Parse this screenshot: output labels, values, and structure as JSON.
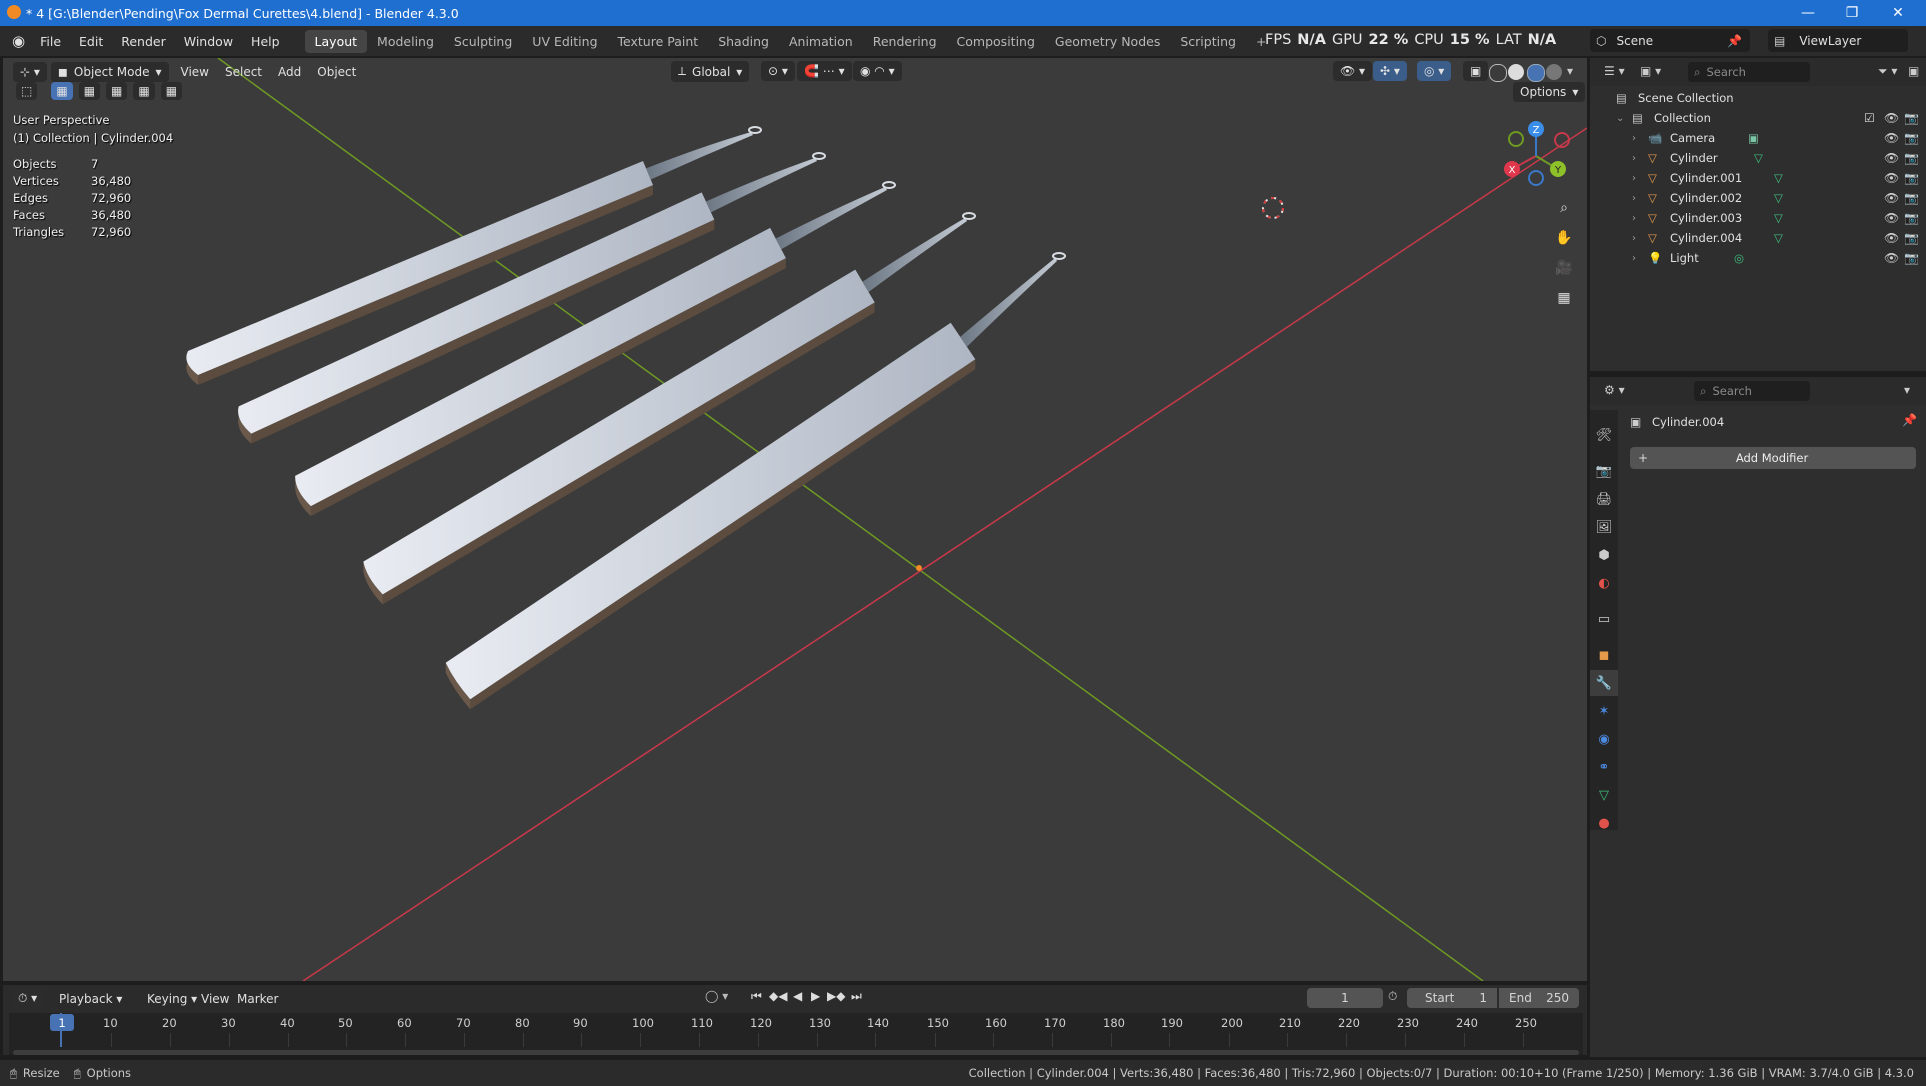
{
  "window": {
    "title": "* 4 [G:\\Blender\\Pending\\Fox Dermal Curettes\\4.blend] - Blender 4.3.0",
    "minimize": "—",
    "maximize": "❐",
    "close": "✕"
  },
  "menu": {
    "items": [
      "File",
      "Edit",
      "Render",
      "Window",
      "Help"
    ],
    "workspaces": [
      "Layout",
      "Modeling",
      "Sculpting",
      "UV Editing",
      "Texture Paint",
      "Shading",
      "Animation",
      "Rendering",
      "Compositing",
      "Geometry Nodes",
      "Scripting"
    ],
    "active_workspace": "Layout",
    "add_workspace": "+",
    "stats": {
      "fps_label": "FPS",
      "fps_value": "N/A",
      "gpu_label": "GPU",
      "gpu_value": "22 %",
      "cpu_label": "CPU",
      "cpu_value": "15 %",
      "lat_label": "LAT",
      "lat_value": "N/A"
    },
    "scene": "Scene",
    "view_layer": "ViewLayer"
  },
  "viewport_header": {
    "mode": "Object Mode",
    "view": "View",
    "select": "Select",
    "add": "Add",
    "object": "Object",
    "orientation": "Global",
    "options": "Options"
  },
  "viewport_overlay": {
    "perspective": "User Perspective",
    "context": "(1) Collection | Cylinder.004",
    "stats": [
      {
        "label": "Objects",
        "value": "7"
      },
      {
        "label": "Vertices",
        "value": "36,480"
      },
      {
        "label": "Edges",
        "value": "72,960"
      },
      {
        "label": "Faces",
        "value": "36,480"
      },
      {
        "label": "Triangles",
        "value": "72,960"
      }
    ]
  },
  "gizmo": {
    "x": "X",
    "y": "Y",
    "z": "Z"
  },
  "outliner": {
    "search_placeholder": "Search",
    "scene_collection": "Scene Collection",
    "collection": "Collection",
    "items": [
      "Camera",
      "Cylinder",
      "Cylinder.001",
      "Cylinder.002",
      "Cylinder.003",
      "Cylinder.004",
      "Light"
    ]
  },
  "properties": {
    "search_placeholder": "Search",
    "object_name": "Cylinder.004",
    "add_modifier": "Add Modifier"
  },
  "timeline": {
    "playback": "Playback",
    "keying": "Keying",
    "view": "View",
    "marker": "Marker",
    "current_frame": "1",
    "start_label": "Start",
    "start": "1",
    "end_label": "End",
    "end": "250",
    "ticks": [
      "1",
      "10",
      "20",
      "30",
      "40",
      "50",
      "60",
      "70",
      "80",
      "90",
      "100",
      "110",
      "120",
      "130",
      "140",
      "150",
      "160",
      "170",
      "180",
      "190",
      "200",
      "210",
      "220",
      "230",
      "240",
      "250"
    ]
  },
  "statusbar": {
    "resize": "Resize",
    "options": "Options",
    "info": "Collection | Cylinder.004 | Verts:36,480 | Faces:36,480 | Tris:72,960 | Objects:0/7 | Duration: 00:10+10 (Frame 1/250) | Memory: 1.36 GiB | VRAM: 3.7/4.0 GiB | 4.3.0"
  },
  "colors": {
    "accent": "#1f6fd1",
    "active_frame": "#4772b3",
    "x_axis": "#c8384a",
    "y_axis": "#6e9a23"
  }
}
